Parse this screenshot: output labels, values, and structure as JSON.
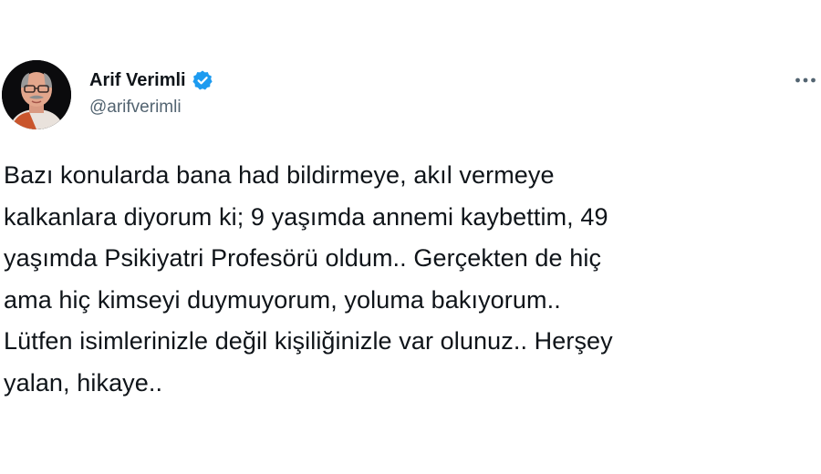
{
  "author": {
    "display_name": "Arif Verimli",
    "handle": "@arifverimli",
    "verified": true,
    "verified_color": "#1d9bf0"
  },
  "menu": {
    "icon": "more-horizontal-icon"
  },
  "tweet": {
    "lines": [
      "Bazı konularda bana had bildirmeye, akıl vermeye",
      "kalkanlara diyorum ki; 9 yaşımda annemi kaybettim, 49",
      "yaşımda Psikiyatri Profesörü oldum.. Gerçekten de hiç",
      "ama hiç kimseyi duymuyorum, yoluma bakıyorum..",
      "Lütfen isimlerinizle değil kişiliğinizle var olunuz.. Herşey",
      "yalan, hikaye.."
    ]
  }
}
